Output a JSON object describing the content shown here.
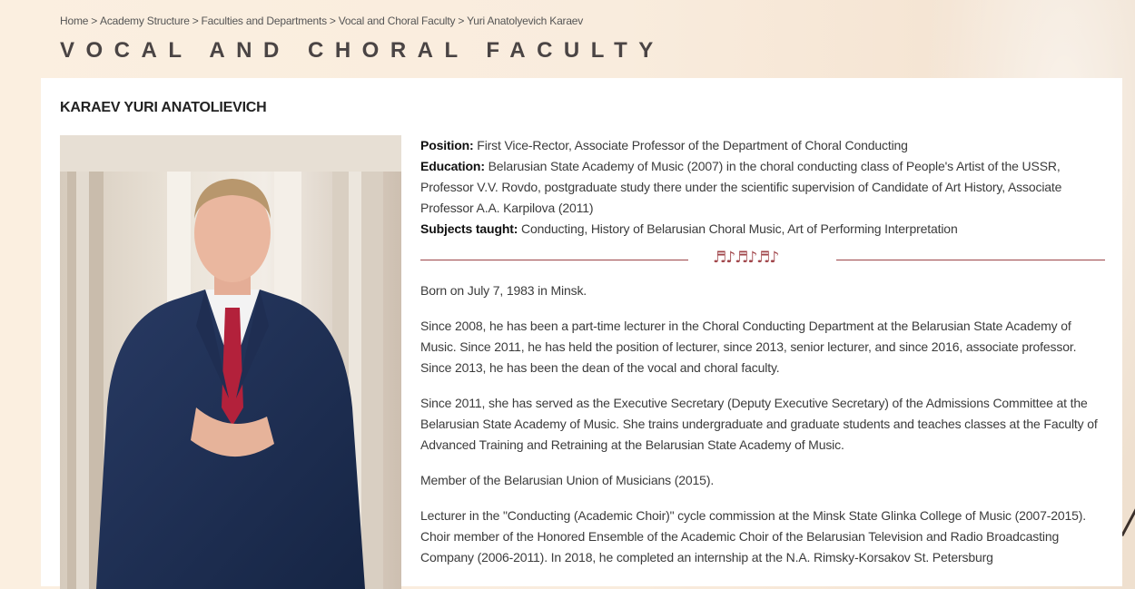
{
  "breadcrumb": {
    "items": [
      "Home",
      "Academy Structure",
      "Faculties and Departments",
      "Vocal and Choral Faculty",
      "Yuri Anatolyevich Karaev"
    ],
    "separator": ">"
  },
  "page_title": "VOCAL AND CHORAL FACULTY",
  "person": {
    "name": "KARAEV YURI ANATOLIEVICH",
    "position_label": "Position:",
    "position_value": " First Vice-Rector, Associate Professor of the Department of Choral Conducting",
    "education_label": "Education:",
    "education_value": " Belarusian State Academy of Music (2007) in the choral conducting class of People's Artist of the USSR, Professor V.V. Rovdo, postgraduate study there under the scientific supervision of Candidate of Art History, Associate Professor A.A. Karpilova (2011)",
    "subjects_label": "Subjects taught:",
    "subjects_value": " Conducting, History of Belarusian Choral Music, Art of Performing Interpretation",
    "divider_ornament": "♬♪♬♪♬♪",
    "bio": [
      "Born on July 7, 1983 in Minsk.",
      "Since 2008, he has been a part-time lecturer in the Choral Conducting Department at the Belarusian State Academy of Music. Since 2011, he has held the position of lecturer, since 2013, senior lecturer, and since 2016, associate professor. Since 2013, he has been the dean of the vocal and choral faculty.",
      "Since 2011, she has served as the Executive Secretary (Deputy Executive Secretary) of the Admissions Committee at the Belarusian State Academy of Music. She trains undergraduate and graduate students and teaches classes at the Faculty of Advanced Training and Retraining at the Belarusian State Academy of Music.",
      "Member of the Belarusian Union of Musicians (2015).",
      "Lecturer in the \"Conducting (Academic Choir)\" cycle commission at the Minsk State Glinka College of Music (2007-2015). Choir member of the Honored Ensemble of the Academic Choir of the Belarusian Television and Radio Broadcasting Company (2006-2011). In 2018, he completed an internship at the N.A. Rimsky-Korsakov St. Petersburg"
    ]
  },
  "colors": {
    "accent": "#9c4448",
    "background": "#fbefe0",
    "card": "#ffffff",
    "title": "#4a4444"
  }
}
